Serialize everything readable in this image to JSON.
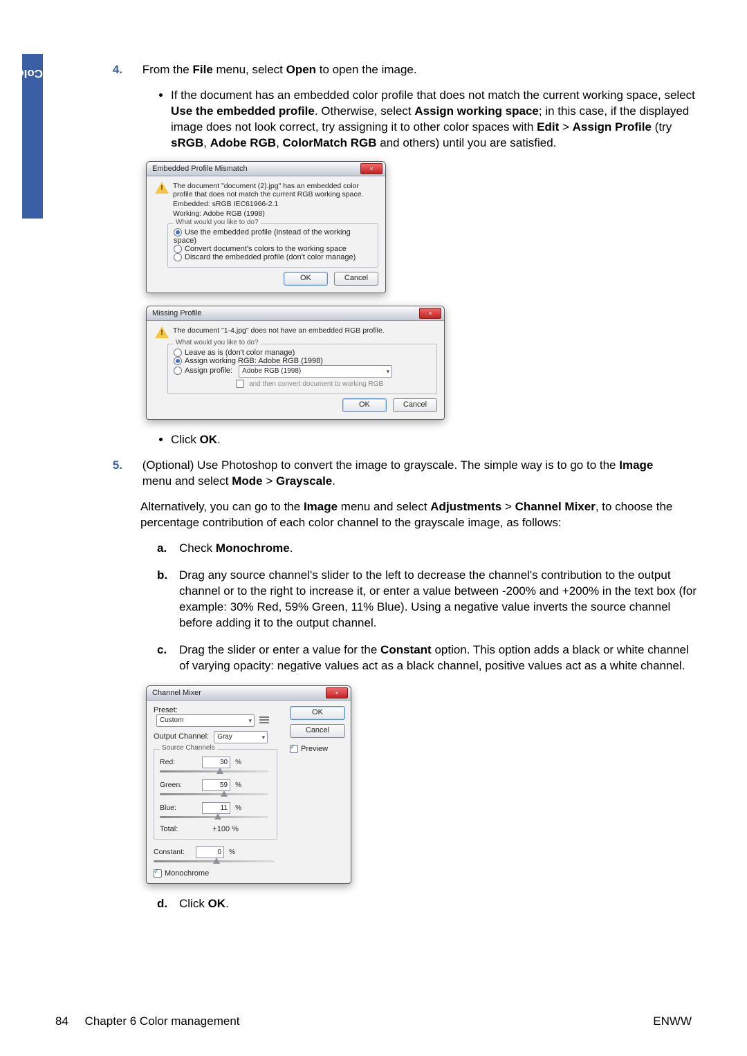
{
  "sidebar": {
    "label": "Color management"
  },
  "steps": {
    "s4": {
      "num": "4.",
      "intro_pre": "From the ",
      "intro_file": "File",
      "intro_mid": " menu, select ",
      "intro_open": "Open",
      "intro_post": " to open the image.",
      "bullet1_a": "If the document has an embedded color profile that does not match the current working space, select ",
      "bullet1_b": "Use the embedded profile",
      "bullet1_c": ". Otherwise, select ",
      "bullet1_d": "Assign working space",
      "bullet1_e": "; in this case, if the displayed image does not look correct, try assigning it to other color spaces with ",
      "bullet1_f": "Edit",
      "bullet1_g": " > ",
      "bullet1_h": "Assign Profile",
      "bullet1_i": " (try ",
      "bullet1_j": "sRGB",
      "bullet1_k": ", ",
      "bullet1_l": "Adobe RGB",
      "bullet1_m": ", ",
      "bullet1_n": "ColorMatch RGB",
      "bullet1_o": " and others) until you are satisfied.",
      "bullet2_a": "Click ",
      "bullet2_b": "OK",
      "bullet2_c": "."
    },
    "s5": {
      "num": "5.",
      "p1_a": "(Optional) Use Photoshop to convert the image to grayscale. The simple way is to go to the ",
      "p1_b": "Image",
      "p1_c": " menu and select ",
      "p1_d": "Mode",
      "p1_e": " > ",
      "p1_f": "Grayscale",
      "p1_g": ".",
      "p2_a": "Alternatively, you can go to the ",
      "p2_b": "Image",
      "p2_c": " menu and select ",
      "p2_d": "Adjustments",
      "p2_e": " > ",
      "p2_f": "Channel Mixer",
      "p2_g": ", to choose the percentage contribution of each color channel to the grayscale image, as follows:",
      "a_lbl": "a.",
      "a_a": "Check ",
      "a_b": "Monochrome",
      "a_c": ".",
      "b_lbl": "b.",
      "b_txt": "Drag any source channel's slider to the left to decrease the channel's contribution to the output channel or to the right to increase it, or enter a value between -200% and +200% in the text box (for example: 30% Red, 59% Green, 11% Blue). Using a negative value inverts the source channel before adding it to the output channel.",
      "c_lbl": "c.",
      "c_a": "Drag the slider or enter a value for the ",
      "c_b": "Constant",
      "c_c": " option. This option adds a black or white channel of varying opacity: negative values act as a black channel, positive values act as a white channel.",
      "d_lbl": "d.",
      "d_a": "Click ",
      "d_b": "OK",
      "d_c": "."
    }
  },
  "dlg1": {
    "title": "Embedded Profile Mismatch",
    "close": "×",
    "msg": "The document \"document (2).jpg\" has an embedded color profile that does not match the current RGB working space.",
    "embedded_lbl": "Embedded:  sRGB IEC61966-2.1",
    "working_lbl": "Working:  Adobe RGB (1998)",
    "legend": "What would you like to do?",
    "opt1": "Use the embedded profile (instead of the working space)",
    "opt2": "Convert document's colors to the working space",
    "opt3": "Discard the embedded profile (don't color manage)",
    "ok": "OK",
    "cancel": "Cancel"
  },
  "dlg2": {
    "title": "Missing Profile",
    "close": "×",
    "msg": "The document \"1-4.jpg\" does not have an embedded RGB profile.",
    "legend": "What would you like to do?",
    "opt1": "Leave as is (don't color manage)",
    "opt2": "Assign working RGB:  Adobe RGB (1998)",
    "opt3_a": "Assign profile:",
    "opt3_b": "Adobe RGB (1998)",
    "opt3_chk": "and then convert document to working RGB",
    "ok": "OK",
    "cancel": "Cancel"
  },
  "cm": {
    "title": "Channel Mixer",
    "close": "×",
    "preset_lbl": "Preset:",
    "preset_val": "Custom",
    "output_lbl": "Output Channel:",
    "output_val": "Gray",
    "src_legend": "Source Channels",
    "red_lbl": "Red:",
    "red_val": "30",
    "green_lbl": "Green:",
    "green_val": "59",
    "blue_lbl": "Blue:",
    "blue_val": "11",
    "total_lbl": "Total:",
    "total_val": "+100",
    "pct": "%",
    "constant_lbl": "Constant:",
    "constant_val": "0",
    "mono": "Monochrome",
    "ok": "OK",
    "cancel": "Cancel",
    "preview": "Preview"
  },
  "footer": {
    "page": "84",
    "chapter": "Chapter 6   Color management",
    "brand": "ENWW"
  }
}
